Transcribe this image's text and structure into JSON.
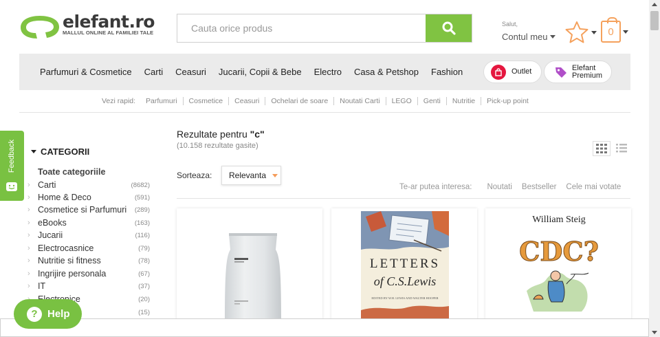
{
  "header": {
    "logo_text": "elefant.ro",
    "logo_tagline": "MALLUL ONLINE AL FAMILIEI TALE",
    "search_placeholder": "Cauta orice produs",
    "greeting": "Salut,",
    "account_label": "Contul meu",
    "cart_count": "0",
    "brand_color": "#80c342",
    "accent_color": "#f5a15c"
  },
  "nav": {
    "items": [
      "Parfumuri & Cosmetice",
      "Carti",
      "Ceasuri",
      "Jucarii, Copii & Bebe",
      "Electro",
      "Casa & Petshop",
      "Fashion"
    ],
    "outlet_label": "Outlet",
    "premium_line1": "Elefant",
    "premium_line2": "Premium"
  },
  "quick_links": {
    "label": "Vezi rapid:",
    "items": [
      "Parfumuri",
      "Cosmetice",
      "Ceasuri",
      "Ochelari de soare",
      "Noutati Carti",
      "LEGO",
      "Genti",
      "Nutritie",
      "Pick-up point"
    ]
  },
  "feedback_label": "Feedback",
  "sidebar": {
    "heading": "CATEGORII",
    "all_label": "Toate categoriile",
    "categories": [
      {
        "name": "Carti",
        "count": "(8682)"
      },
      {
        "name": "Home & Deco",
        "count": "(591)"
      },
      {
        "name": "Cosmetice si Parfumuri",
        "count": "(289)"
      },
      {
        "name": "eBooks",
        "count": "(163)"
      },
      {
        "name": "Jucarii",
        "count": "(116)"
      },
      {
        "name": "Electrocasnice",
        "count": "(79)"
      },
      {
        "name": "Nutritie si fitness",
        "count": "(78)"
      },
      {
        "name": "Ingrijire personala",
        "count": "(67)"
      },
      {
        "name": "IT",
        "count": "(37)"
      },
      {
        "name": "Electronice",
        "count": "(20)"
      },
      {
        "name": "",
        "count": "(15)"
      }
    ]
  },
  "results": {
    "title_prefix": "Rezultate pentru ",
    "query": "\"c\"",
    "count_text": "(10.158 rezultate gasite)",
    "sort_label": "Sorteaza:",
    "sort_value": "Relevanta",
    "interest_label": "Te-ar putea interesa:",
    "interest_links": [
      "Noutati",
      "Bestseller",
      "Cele mai votate"
    ]
  },
  "products": [
    {
      "name": "product-pouch",
      "cover_text": ""
    },
    {
      "name": "product-letters-cs-lewis",
      "cover_title_1": "LETTERS",
      "cover_title_2": "of C.S.Lewis",
      "cover_credit": "EDITED BY W.H. LEWIS AND WALTER HOOPER"
    },
    {
      "name": "product-cdc",
      "cover_author": "William Steig",
      "cover_title": "CDC?"
    }
  ],
  "help_label": "Help"
}
